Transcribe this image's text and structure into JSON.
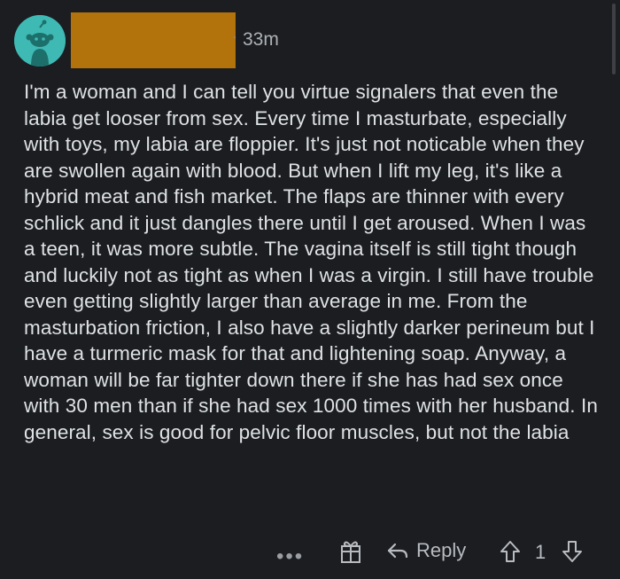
{
  "comment": {
    "timestamp": "33m",
    "body": "I'm a woman and I can tell you virtue signalers that even the labia get looser from sex. Every time I masturbate, especially with toys, my labia are floppier. It's just not noticable when they are swollen again with blood. But when I lift my leg, it's like a hybrid meat and fish market. The flaps are thinner with every schlick and it just dangles there until I get aroused. When I was a teen, it was more subtle. The vagina itself is still tight though and luckily not as tight as when I was a virgin. I still have trouble even getting slightly larger than average in me. From the masturbation friction, I also have a slightly darker perineum but I have a turmeric mask for that and lightening soap. Anyway, a woman will be far tighter down there if she has had sex once with 30 men than if she had sex 1000 times with her husband. In general, sex is good for pelvic floor muscles, but not the labia"
  },
  "actions": {
    "more_label": "•••",
    "reply_label": "Reply",
    "vote_count": "1"
  },
  "colors": {
    "background": "#1b1d21",
    "avatar": "#3fb9b3",
    "redaction": "#b2720c"
  },
  "icons": [
    "reddit-snoo-avatar-icon",
    "award-gift-icon",
    "reply-arrow-icon",
    "upvote-arrow-icon",
    "downvote-arrow-icon"
  ]
}
